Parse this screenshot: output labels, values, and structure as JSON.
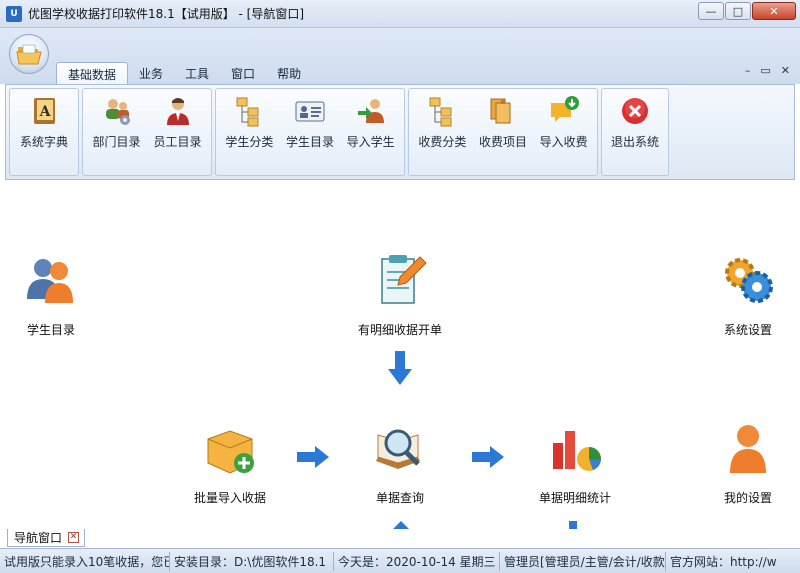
{
  "window": {
    "logo": "U",
    "title": "优图学校收据打印软件18.1【试用版】 - [导航窗口]",
    "minimize": "—",
    "maximize": "□",
    "close": "✕"
  },
  "tabs": [
    {
      "label": "基础数据",
      "active": true
    },
    {
      "label": "业务"
    },
    {
      "label": "工具"
    },
    {
      "label": "窗口"
    },
    {
      "label": "帮助"
    }
  ],
  "mdi_controls": {
    "minimize": "–",
    "restore": "▭",
    "close": "✕"
  },
  "ribbon": {
    "system_dictionary": "系统字典",
    "department_list": "部门目录",
    "employee_list": "员工目录",
    "student_category": "学生分类",
    "student_list": "学生目录",
    "import_students": "导入学生",
    "fee_category": "收费分类",
    "fee_items": "收费项目",
    "import_fees": "导入收费",
    "exit_system": "退出系统"
  },
  "nav": {
    "student_list": "学生目录",
    "detailed_receipt": "有明细收据开单",
    "system_settings": "系统设置",
    "batch_import": "批量导入收据",
    "receipt_query": "单据查询",
    "receipt_stats": "单据明细统计",
    "my_settings": "我的设置"
  },
  "doc_tab": {
    "label": "导航窗口",
    "close": "✕"
  },
  "status": {
    "trial_notice": "试用版只能录入10笔收据，您已",
    "install_dir": "安装目录：D:\\优图软件18.1",
    "today": "今天是：2020-10-14 星期三 庚",
    "user": "管理员[管理员/主管/会计/收款",
    "website": "官方网站：http://w"
  }
}
